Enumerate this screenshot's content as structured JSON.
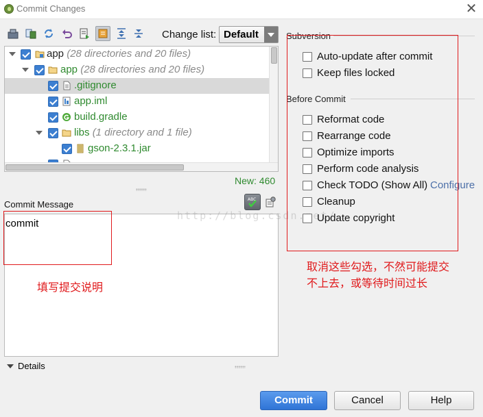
{
  "window": {
    "title": "Commit Changes"
  },
  "toolbar": {
    "changelist_label": "Change list:",
    "changelist_value": "Default",
    "icons": [
      "pack-icon",
      "diff-icon",
      "refresh-icon",
      "revert-icon",
      "history-icon",
      "group-by-icon",
      "expand-all-icon",
      "collapse-all-icon"
    ]
  },
  "tree": {
    "rows": [
      {
        "label": "app",
        "meta": "(28 directories and 20 files)",
        "kind": "module"
      },
      {
        "label": "app",
        "meta": "(28 directories and 20 files)",
        "kind": "folder"
      },
      {
        "label": ".gitignore",
        "meta": "",
        "kind": "text-file"
      },
      {
        "label": "app.iml",
        "meta": "",
        "kind": "iml-file"
      },
      {
        "label": "build.gradle",
        "meta": "",
        "kind": "gradle-file"
      },
      {
        "label": "libs",
        "meta": "(1 directory and 1 file)",
        "kind": "folder"
      },
      {
        "label": "gson-2.3.1.jar",
        "meta": "",
        "kind": "jar-file"
      }
    ],
    "new_count": "New: 460"
  },
  "commit_message": {
    "label": "Commit Message",
    "value": "commit"
  },
  "details": {
    "label": "Details"
  },
  "subversion": {
    "title": "Subversion",
    "options": [
      {
        "label": "Auto-update after commit",
        "checked": false
      },
      {
        "label": "Keep files locked",
        "checked": false
      }
    ]
  },
  "before_commit": {
    "title": "Before Commit",
    "options": [
      {
        "label": "Reformat code",
        "checked": false
      },
      {
        "label": "Rearrange code",
        "checked": false
      },
      {
        "label": "Optimize imports",
        "checked": false
      },
      {
        "label": "Perform code analysis",
        "checked": false
      },
      {
        "label": "Check TODO (Show All)",
        "checked": false
      },
      {
        "label": "Cleanup",
        "checked": false
      },
      {
        "label": "Update copyright",
        "checked": false
      }
    ],
    "configure_link": "Configure"
  },
  "annotations": {
    "message_note": "填写提交说明",
    "options_note_line1": "取消这些勾选，不然可能提交",
    "options_note_line2": "不上去，或等待时间过长",
    "watermark": "http://blog.csdn.net/",
    "color": "#e0191b"
  },
  "buttons": {
    "commit": "Commit",
    "cancel": "Cancel",
    "help": "Help"
  }
}
